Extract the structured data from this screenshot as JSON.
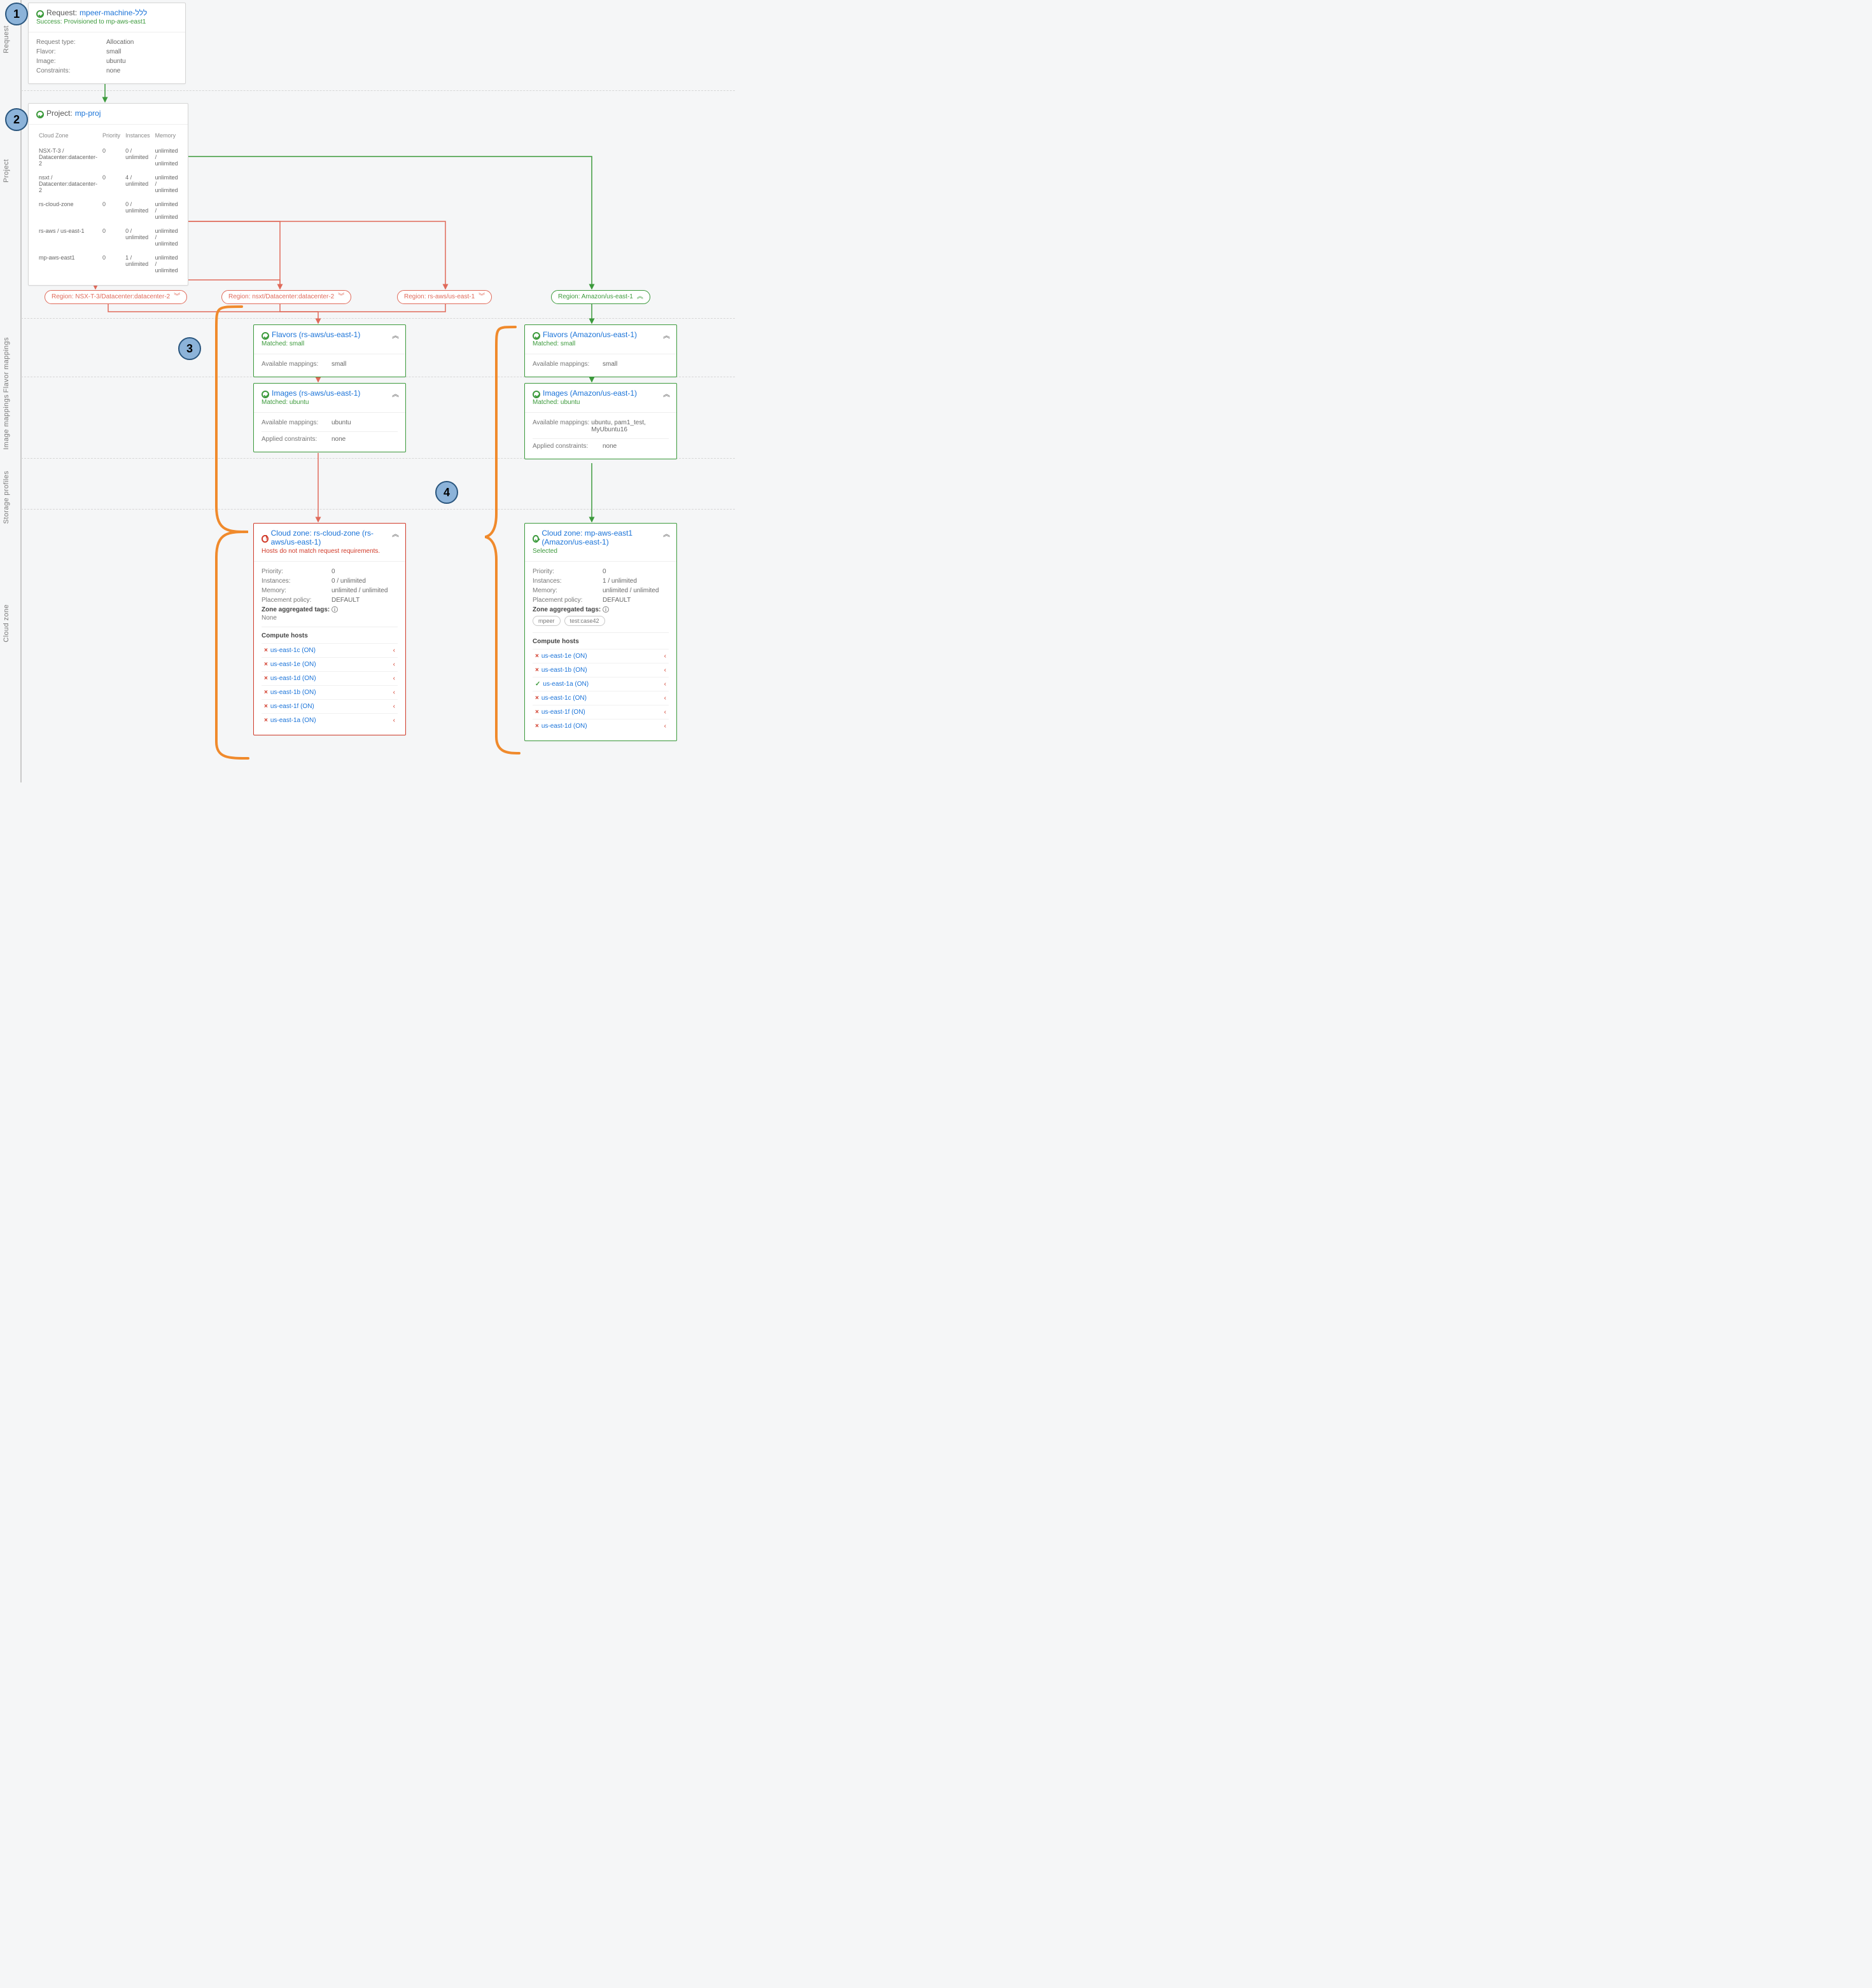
{
  "lanes": {
    "request": "Request",
    "project": "Project",
    "flavor": "Flavor mappings",
    "image": "Image mappings",
    "storage": "Storage profiles",
    "cloudzone": "Cloud zone"
  },
  "callouts": {
    "c1": "1",
    "c2": "2",
    "c3": "3",
    "c4": "4"
  },
  "request": {
    "title_prefix": "Request: ",
    "name": "mpeer-machine-ללל",
    "status": "Success: Provisioned to mp-aws-east1",
    "type": "Allocation",
    "flavor": "small",
    "image": "ubuntu",
    "constraints": "none",
    "labels": {
      "type": "Request type:",
      "flavor": "Flavor:",
      "image": "Image:",
      "constraints": "Constraints:"
    }
  },
  "project": {
    "title_prefix": "Project: ",
    "name": "mp-proj",
    "cols": {
      "zone": "Cloud Zone",
      "priority": "Priority",
      "instances": "Instances",
      "memory": "Memory"
    },
    "rows": [
      {
        "zone": "NSX-T-3 / Datacenter:datacenter-2",
        "priority": "0",
        "instances": "0 / unlimited",
        "memory": "unlimited / unlimited"
      },
      {
        "zone": "nsxt / Datacenter:datacenter-2",
        "priority": "0",
        "instances": "4 / unlimited",
        "memory": "unlimited / unlimited"
      },
      {
        "zone": "rs-cloud-zone",
        "priority": "0",
        "instances": "0 / unlimited",
        "memory": "unlimited / unlimited"
      },
      {
        "zone": "rs-aws / us-east-1",
        "priority": "0",
        "instances": "0 / unlimited",
        "memory": "unlimited / unlimited"
      },
      {
        "zone": "mp-aws-east1",
        "priority": "0",
        "instances": "1 / unlimited",
        "memory": "unlimited / unlimited"
      }
    ]
  },
  "regions": {
    "r1": "Region: NSX-T-3/Datacenter:datacenter-2",
    "r2": "Region: nsxt/Datacenter:datacenter-2",
    "r3": "Region: rs-aws/us-east-1",
    "r4": "Region: Amazon/us-east-1"
  },
  "flavors": {
    "left": {
      "title": "Flavors (rs-aws/us-east-1)",
      "matched": "Matched: small",
      "avail_label": "Available mappings:",
      "avail": "small"
    },
    "right": {
      "title": "Flavors (Amazon/us-east-1)",
      "matched": "Matched: small",
      "avail_label": "Available mappings:",
      "avail": "small"
    }
  },
  "images": {
    "left": {
      "title": "Images (rs-aws/us-east-1)",
      "matched": "Matched: ubuntu",
      "avail_label": "Available mappings:",
      "avail": "ubuntu",
      "applied_label": "Applied constraints:",
      "applied": "none"
    },
    "right": {
      "title": "Images (Amazon/us-east-1)",
      "matched": "Matched: ubuntu",
      "avail_label": "Available mappings:",
      "avail": "ubuntu, pam1_test, MyUbuntu16",
      "applied_label": "Applied constraints:",
      "applied": "none"
    }
  },
  "czlabels": {
    "priority": "Priority:",
    "instances": "Instances:",
    "memory": "Memory:",
    "placement": "Placement policy:",
    "zat": "Zone aggregated tags:",
    "hosts": "Compute hosts",
    "none": "None"
  },
  "czleft": {
    "title": "Cloud zone: rs-cloud-zone (rs-aws/us-east-1)",
    "sub": "Hosts do not match request requirements.",
    "priority": "0",
    "instances": "0 / unlimited",
    "memory": "unlimited / unlimited",
    "placement": "DEFAULT",
    "hosts": [
      {
        "ok": false,
        "name": "us-east-1c (ON)"
      },
      {
        "ok": false,
        "name": "us-east-1e (ON)"
      },
      {
        "ok": false,
        "name": "us-east-1d (ON)"
      },
      {
        "ok": false,
        "name": "us-east-1b (ON)"
      },
      {
        "ok": false,
        "name": "us-east-1f (ON)"
      },
      {
        "ok": false,
        "name": "us-east-1a (ON)"
      }
    ]
  },
  "czright": {
    "title": "Cloud zone: mp-aws-east1 (Amazon/us-east-1)",
    "sub": "Selected",
    "priority": "0",
    "instances": "1 / unlimited",
    "memory": "unlimited / unlimited",
    "placement": "DEFAULT",
    "tags": [
      "mpeer",
      "test:case42"
    ],
    "hosts": [
      {
        "ok": false,
        "name": "us-east-1e (ON)"
      },
      {
        "ok": false,
        "name": "us-east-1b (ON)"
      },
      {
        "ok": true,
        "name": "us-east-1a (ON)"
      },
      {
        "ok": false,
        "name": "us-east-1c (ON)"
      },
      {
        "ok": false,
        "name": "us-east-1f (ON)"
      },
      {
        "ok": false,
        "name": "us-east-1d (ON)"
      }
    ]
  },
  "chevrons": {
    "down": "⌄",
    "up": "︿",
    "right": "›",
    "dcollapse": "︾",
    "dexpand": "︽"
  }
}
